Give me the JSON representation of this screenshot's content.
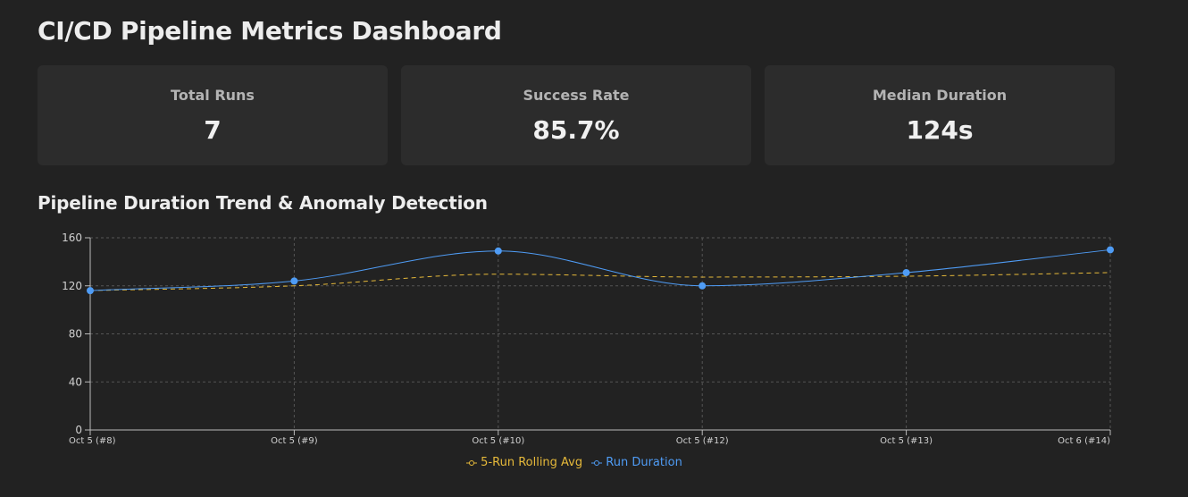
{
  "header": {
    "title": "CI/CD Pipeline Metrics Dashboard"
  },
  "cards": [
    {
      "label": "Total Runs",
      "value": "7"
    },
    {
      "label": "Success Rate",
      "value": "85.7%"
    },
    {
      "label": "Median Duration",
      "value": "124s"
    }
  ],
  "section": {
    "title": "Pipeline Duration Trend & Anomaly Detection"
  },
  "colors": {
    "duration": "#4f9cf5",
    "rolling": "#e6b93a",
    "grid": "#555555",
    "axis": "#bbbbbb",
    "tick_text": "#d0d0d0"
  },
  "chart_data": {
    "type": "line",
    "categories": [
      "Oct 5 (#8)",
      "Oct 5 (#9)",
      "Oct 5 (#10)",
      "Oct 5 (#12)",
      "Oct 5 (#13)",
      "Oct 6 (#14)"
    ],
    "series": [
      {
        "name": "Run Duration",
        "values": [
          116,
          124,
          149,
          120,
          131,
          150
        ],
        "style": "solid",
        "markers": true
      },
      {
        "name": "5-Run Rolling Avg",
        "values": [
          116,
          120,
          129.7,
          127.3,
          128,
          131
        ],
        "style": "dashed",
        "markers": false
      }
    ],
    "legend_order": [
      "5-Run Rolling Avg",
      "Run Duration"
    ],
    "y_ticks": [
      0,
      40,
      80,
      120,
      160
    ],
    "ylim": [
      0,
      160
    ],
    "grid": true,
    "legend_position": "bottom-center",
    "title": "",
    "xlabel": "",
    "ylabel": ""
  }
}
